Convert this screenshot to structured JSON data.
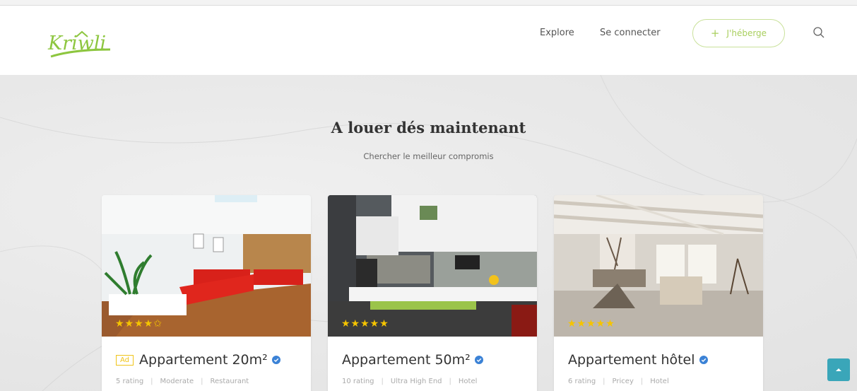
{
  "brand": {
    "logo_text": "Kriwli",
    "logo_color": "#8dc63f"
  },
  "nav": {
    "explore": "Explore",
    "login": "Se connecter",
    "host_label": "J'héberge",
    "host_icon": "plus-icon",
    "search_icon": "search-icon"
  },
  "section": {
    "title": "A louer dés maintenant",
    "subtitle": "Chercher le meilleur compromis"
  },
  "cards": [
    {
      "ad": "Ad",
      "title": "Appartement 20m²",
      "rating_count": "5 rating",
      "price_level": "Moderate",
      "category": "Restaurant",
      "stars": "★★★★✩",
      "rating": 4.5
    },
    {
      "ad": "",
      "title": "Appartement 50m²",
      "rating_count": "10 rating",
      "price_level": "Ultra High End",
      "category": "Hotel",
      "stars": "★★★★★",
      "rating": 5
    },
    {
      "ad": "",
      "title": "Appartement hôtel",
      "rating_count": "6 rating",
      "price_level": "Pricey",
      "category": "Hotel",
      "stars": "★★★★★",
      "rating": 5
    }
  ],
  "colors": {
    "accent_green": "#a9cf5e",
    "star": "#f5c400",
    "verified_blue": "#3b82d6",
    "scroll_button": "#3aa6b9"
  }
}
